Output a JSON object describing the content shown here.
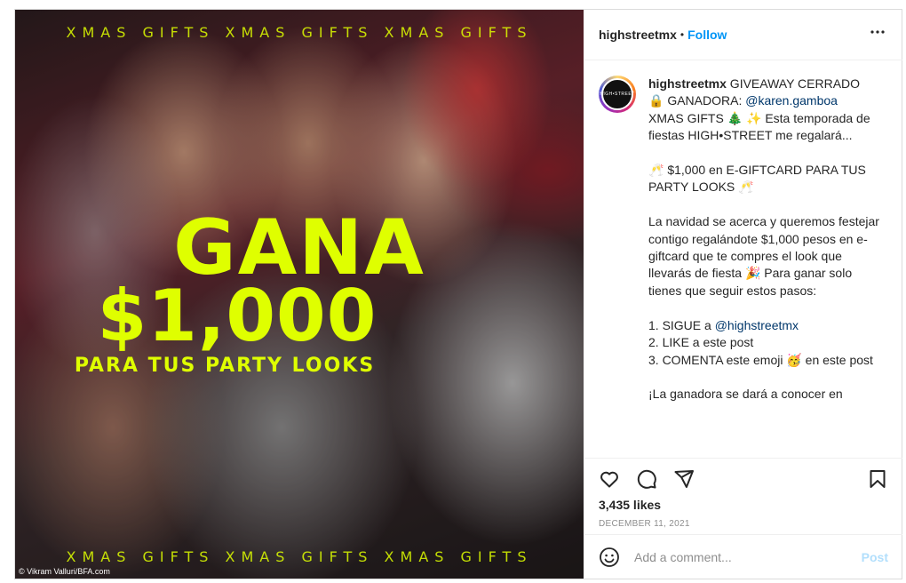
{
  "media": {
    "band_text": "XMAS GIFTS XMAS GIFTS XMAS GIFTS",
    "headline": "GANA",
    "amount": "$1,000",
    "subline": "PARA TUS PARTY LOOKS",
    "credit": "© Vikram Valluri/BFA.com"
  },
  "header": {
    "username": "highstreetmx",
    "separator": "•",
    "follow_label": "Follow",
    "more_icon": "more-horizontal-icon"
  },
  "caption": {
    "avatar_text": "HIGH•STREET",
    "username": "highstreetmx",
    "line1": " GIVEAWAY CERRADO",
    "line2a": "🔒 GANADORA: ",
    "mention_winner": "@karen.gamboa",
    "line3": "XMAS GIFTS 🎄 ✨ Esta temporada de fiestas HIGH•STREET me regalará...",
    "line4": "🥂 $1,000 en E-GIFTCARD PARA TUS PARTY LOOKS 🥂",
    "line5": "La navidad se acerca y queremos festejar contigo regalándote $1,000 pesos en e-giftcard que te compres el look que llevarás de fiesta 🎉 Para ganar solo tienes que seguir estos pasos:",
    "step1a": "1. SIGUE a ",
    "mention_brand": "@highstreetmx",
    "step2": "2. LIKE a este post",
    "step3": "3. COMENTA este emoji 🥳 en este post",
    "line6": "¡La ganadora se dará a conocer en"
  },
  "actions": {
    "like_icon": "heart-icon",
    "comment_icon": "comment-icon",
    "share_icon": "send-icon",
    "save_icon": "bookmark-icon",
    "likes": "3,435 likes",
    "date": "DECEMBER 11, 2021"
  },
  "comment_box": {
    "emoji_icon": "smiley-icon",
    "placeholder": "Add a comment...",
    "post_label": "Post"
  },
  "colors": {
    "accent": "#0095f6",
    "headline": "#dfff00",
    "post_disabled": "#b2dffc"
  }
}
